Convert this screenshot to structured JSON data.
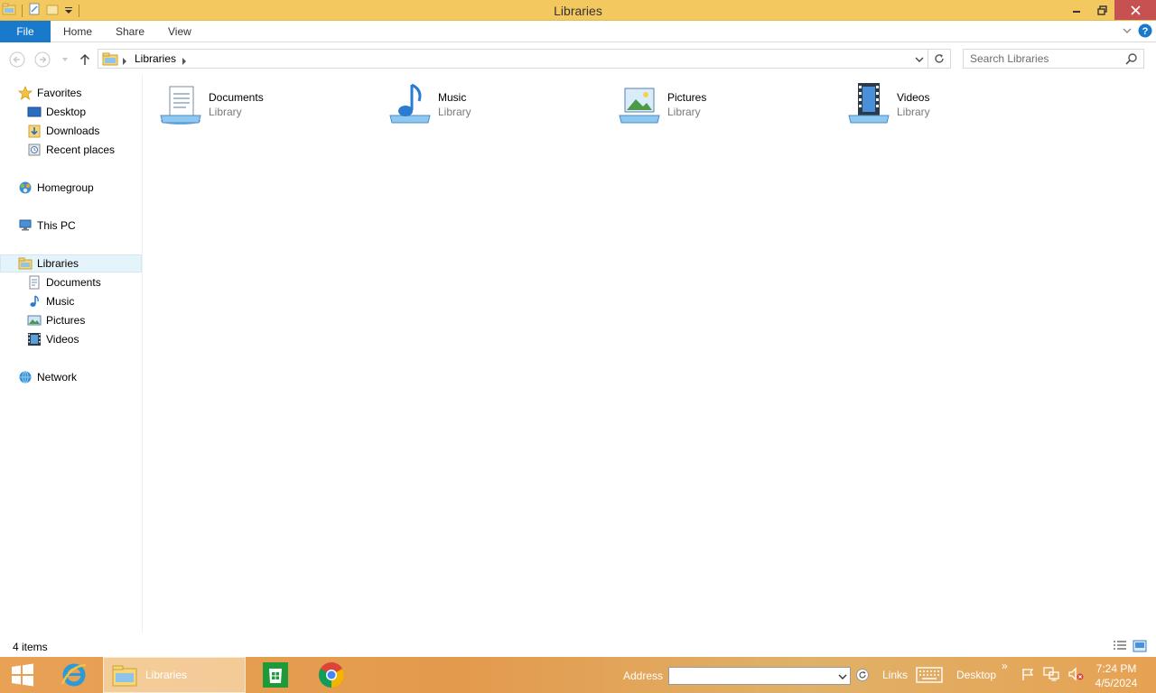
{
  "window": {
    "title": "Libraries",
    "controls": {
      "minimize": "minimize",
      "maximize": "restore",
      "close": "close"
    }
  },
  "ribbon": {
    "tabs": [
      {
        "label": "File"
      },
      {
        "label": "Home"
      },
      {
        "label": "Share"
      },
      {
        "label": "View"
      }
    ]
  },
  "address": {
    "breadcrumb": "Libraries",
    "search_placeholder": "Search Libraries"
  },
  "nav_pane": {
    "favorites": {
      "label": "Favorites",
      "items": [
        {
          "label": "Desktop"
        },
        {
          "label": "Downloads"
        },
        {
          "label": "Recent places"
        }
      ]
    },
    "homegroup": {
      "label": "Homegroup"
    },
    "this_pc": {
      "label": "This PC"
    },
    "libraries": {
      "label": "Libraries",
      "items": [
        {
          "label": "Documents"
        },
        {
          "label": "Music"
        },
        {
          "label": "Pictures"
        },
        {
          "label": "Videos"
        }
      ]
    },
    "network": {
      "label": "Network"
    }
  },
  "content": {
    "tiles": [
      {
        "name": "Documents",
        "type": "Library",
        "icon": "documents-library-icon"
      },
      {
        "name": "Music",
        "type": "Library",
        "icon": "music-library-icon"
      },
      {
        "name": "Pictures",
        "type": "Library",
        "icon": "pictures-library-icon"
      },
      {
        "name": "Videos",
        "type": "Library",
        "icon": "videos-library-icon"
      }
    ]
  },
  "status": {
    "item_count": "4 items"
  },
  "taskbar": {
    "active_window_label": "Libraries",
    "address_label": "Address",
    "links_label": "Links",
    "desktop_label": "Desktop",
    "overflow": "»",
    "time": "7:24 PM",
    "date": "4/5/2024"
  },
  "colors": {
    "titlebar": "#f3c95f",
    "file_tab": "#1979ca",
    "close_button": "#c75050",
    "selection": "#e5f3fb"
  }
}
